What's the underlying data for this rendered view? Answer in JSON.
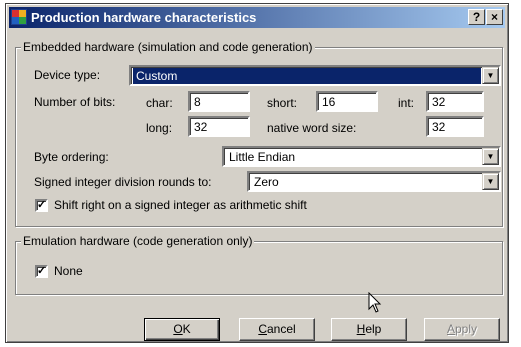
{
  "window": {
    "title": "Production hardware characteristics",
    "help_button": "?",
    "close_button": "×"
  },
  "embedded": {
    "legend": "Embedded hardware (simulation and code generation)",
    "device_type_label": "Device type:",
    "device_type_value": "Custom",
    "num_bits_label": "Number of bits:",
    "char_label": "char:",
    "char_value": "8",
    "short_label": "short:",
    "short_value": "16",
    "int_label": "int:",
    "int_value": "32",
    "long_label": "long:",
    "long_value": "32",
    "native_label": "native word size:",
    "native_value": "32",
    "byte_order_label": "Byte ordering:",
    "byte_order_value": "Little Endian",
    "div_label": "Signed integer division rounds to:",
    "div_value": "Zero",
    "shift_label": "Shift right on a signed integer as arithmetic shift",
    "shift_checked": true
  },
  "emulation": {
    "legend": "Emulation hardware (code generation only)",
    "none_label": "None",
    "none_checked": true
  },
  "buttons": {
    "ok_mnemonic": "O",
    "ok_rest": "K",
    "cancel_mnemonic": "C",
    "cancel_rest": "ancel",
    "help_mnemonic": "H",
    "help_rest": "elp",
    "apply_mnemonic": "A",
    "apply_rest": "pply"
  },
  "glyphs": {
    "check": "✓",
    "dropdown": "▼"
  },
  "colors": {
    "titlebar_start": "#0a246a",
    "titlebar_end": "#a6caf0",
    "face": "#d4d0c8",
    "selection": "#0a246a"
  }
}
